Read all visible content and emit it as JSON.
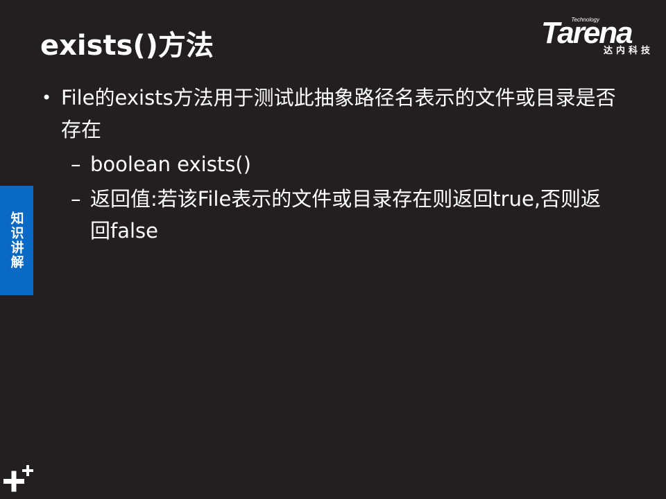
{
  "slide": {
    "title": "exists()方法",
    "logo": {
      "tagline": "Technology",
      "wordmark": "Tarena",
      "subtitle": "达内科技"
    },
    "bullets": [
      {
        "text": "File的exists方法用于测试此抽象路径名表示的文件或目录是否存在",
        "subitems": [
          "boolean exists()",
          "返回值:若该File表示的文件或目录存在则返回true,否则返回false"
        ]
      }
    ],
    "bullet_marker": "•",
    "sub_marker": "–",
    "side_tab": "知识讲解",
    "colors": {
      "background": "#231f20",
      "text": "#ffffff",
      "side_tab": "#0a69c4"
    },
    "icons": [
      "plus-icon"
    ]
  }
}
